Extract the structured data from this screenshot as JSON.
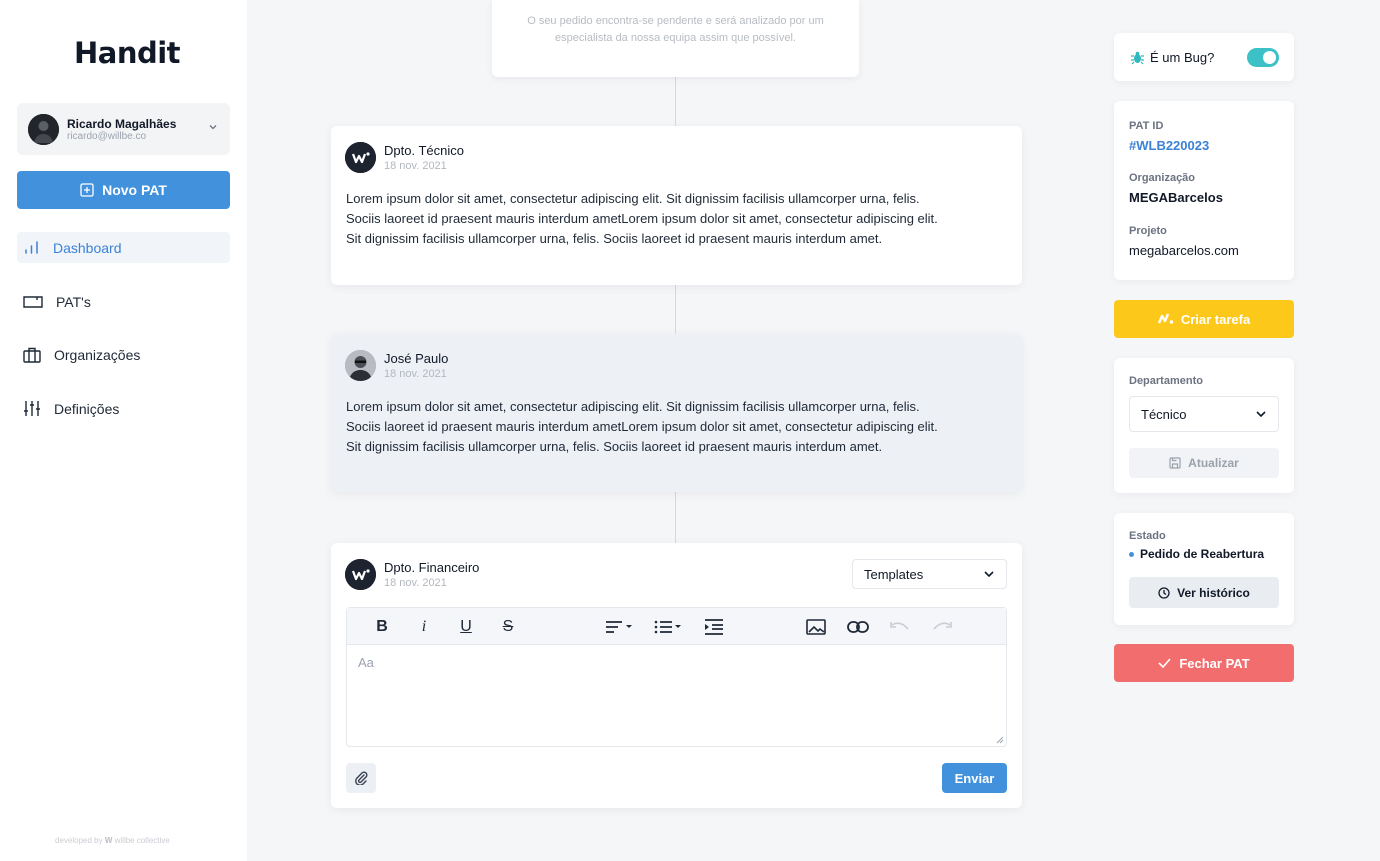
{
  "app": {
    "logo_text": "Handit"
  },
  "user": {
    "name": "Ricardo Magalhães",
    "email": "ricardo@willbe.co"
  },
  "sidebar": {
    "new_button": "Novo PAT",
    "items": [
      {
        "label": "Dashboard",
        "icon": "bar-chart-icon",
        "active": true
      },
      {
        "label": "PAT's",
        "icon": "ticket-icon",
        "active": false
      },
      {
        "label": "Organizações",
        "icon": "briefcase-icon",
        "active": false
      },
      {
        "label": "Definições",
        "icon": "sliders-icon",
        "active": false
      }
    ],
    "footer_prefix": "developed by",
    "footer_brand": "willbe collective"
  },
  "timeline": {
    "pending_text": "O seu pedido encontra-se pendente e será analizado por um especialista da nossa equipa assim que possível.",
    "messages": [
      {
        "author": "Dpto. Técnico",
        "date": "18 nov. 2021",
        "body": "Lorem ipsum dolor sit amet, consectetur adipiscing elit. Sit dignissim facilisis ullamcorper urna, felis. Sociis laoreet id praesent mauris interdum ametLorem ipsum dolor sit amet, consectetur adipiscing elit. Sit dignissim facilisis ullamcorper urna, felis. Sociis laoreet id praesent mauris interdum amet."
      },
      {
        "author": "José Paulo",
        "date": "18 nov. 2021",
        "body": "Lorem ipsum dolor sit amet, consectetur adipiscing elit. Sit dignissim facilisis ullamcorper urna, felis. Sociis laoreet id praesent mauris interdum ametLorem ipsum dolor sit amet, consectetur adipiscing elit. Sit dignissim facilisis ullamcorper urna, felis. Sociis laoreet id praesent mauris interdum amet."
      }
    ],
    "composer": {
      "author": "Dpto. Financeiro",
      "date": "18 nov. 2021",
      "templates_label": "Templates",
      "placeholder": "Aa",
      "send_label": "Enviar"
    }
  },
  "details": {
    "bug_label": "É um Bug?",
    "bug_enabled": true,
    "pat_id_label": "PAT ID",
    "pat_id": "#WLB220023",
    "org_label": "Organização",
    "org": "MEGABarcelos",
    "project_label": "Projeto",
    "project": "megabarcelos.com",
    "create_task": "Criar tarefa",
    "department_label": "Departamento",
    "department": "Técnico",
    "update_label": "Atualizar",
    "state_label": "Estado",
    "state": "Pedido de Reabertura",
    "history_label": "Ver histórico",
    "close_label": "Fechar PAT"
  },
  "colors": {
    "primary": "#4291dc",
    "task": "#fcc91b",
    "danger": "#f26d6d",
    "toggle": "#3cc1c6"
  }
}
